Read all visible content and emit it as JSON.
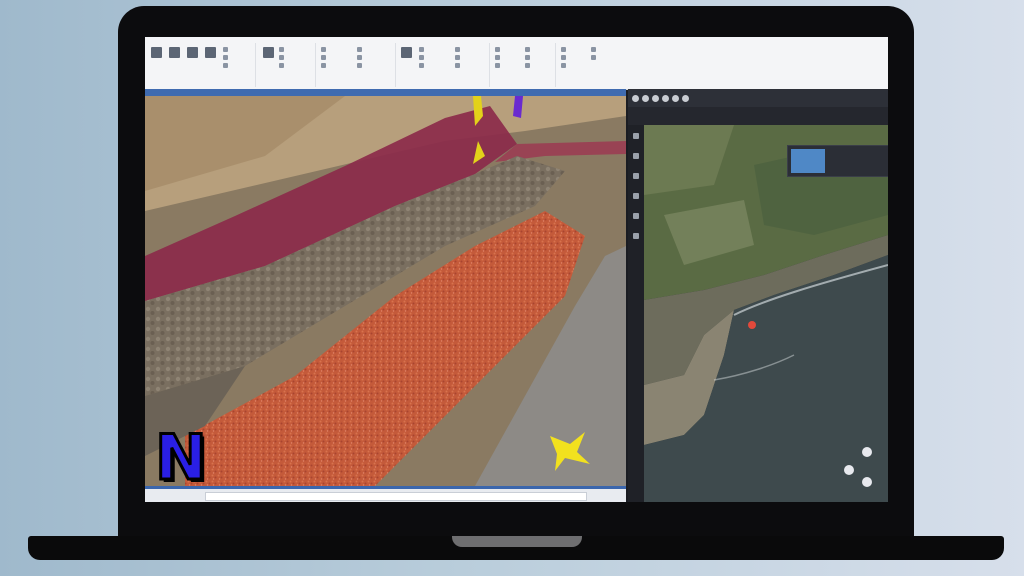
{
  "ribbon": {
    "groups": [
      {
        "label": ""
      },
      {
        "label": ""
      },
      {
        "label": ""
      },
      {
        "label": ""
      },
      {
        "label": ""
      },
      {
        "label": ""
      }
    ]
  },
  "map": {
    "result_title": "",
    "pin_color": "#e2493b"
  },
  "logo": {
    "letter": "N",
    "color": "#2a1fe6"
  },
  "colors": {
    "accent_blue": "#3f6bb0",
    "rock_layer": "#8b2a4a",
    "red_layer": "#c8563a"
  }
}
